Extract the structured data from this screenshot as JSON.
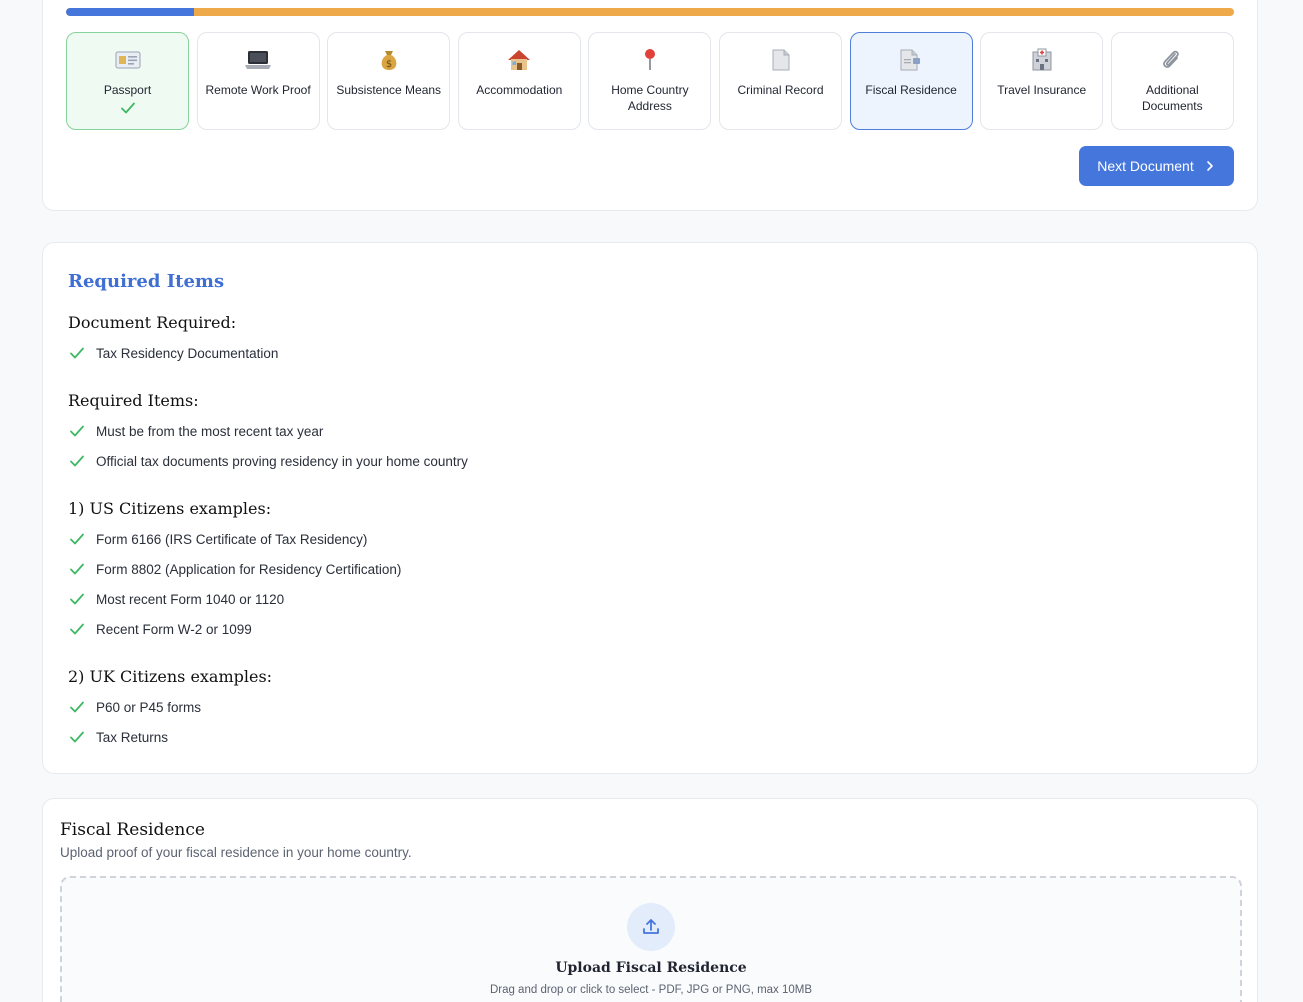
{
  "progress": {
    "fraction": 0.11,
    "fill_color": "#4576dc",
    "track_color": "#eda94a"
  },
  "steps": [
    {
      "label": "Passport",
      "icon": "id-card-icon",
      "state": "completed"
    },
    {
      "label": "Remote Work Proof",
      "icon": "laptop-icon",
      "state": "pending"
    },
    {
      "label": "Subsistence Means",
      "icon": "money-bag-icon",
      "state": "pending"
    },
    {
      "label": "Accommodation",
      "icon": "house-icon",
      "state": "pending"
    },
    {
      "label": "Home Country Address",
      "icon": "pin-icon",
      "state": "pending"
    },
    {
      "label": "Criminal Record",
      "icon": "document-icon",
      "state": "pending"
    },
    {
      "label": "Fiscal Residence",
      "icon": "document-stamp-icon",
      "state": "active"
    },
    {
      "label": "Travel Insurance",
      "icon": "hospital-icon",
      "state": "pending"
    },
    {
      "label": "Additional Documents",
      "icon": "paperclip-icon",
      "state": "pending"
    }
  ],
  "next_button": {
    "label": "Next Document"
  },
  "required": {
    "title": "Required Items",
    "sections": [
      {
        "heading": "Document Required:",
        "items": [
          "Tax Residency Documentation"
        ]
      },
      {
        "heading": "Required Items:",
        "items": [
          "Must be from the most recent tax year",
          "Official tax documents proving residency in your home country"
        ]
      },
      {
        "heading": "1) US Citizens examples:",
        "items": [
          "Form 6166 (IRS Certificate of Tax Residency)",
          "Form 8802 (Application for Residency Certification)",
          "Most recent Form 1040 or 1120",
          "Recent Form W-2 or 1099"
        ]
      },
      {
        "heading": "2) UK Citizens examples:",
        "items": [
          "P60 or P45 forms",
          "Tax Returns"
        ]
      }
    ]
  },
  "upload": {
    "title": "Fiscal Residence",
    "subtitle": "Upload proof of your fiscal residence in your home country.",
    "drop_title": "Upload Fiscal Residence",
    "drop_hint": "Drag and drop or click to select - PDF, JPG or PNG, max 10MB"
  },
  "colors": {
    "accent": "#4576dc",
    "check_green": "#3fb865",
    "heading_blue": "#3f6fd2"
  }
}
